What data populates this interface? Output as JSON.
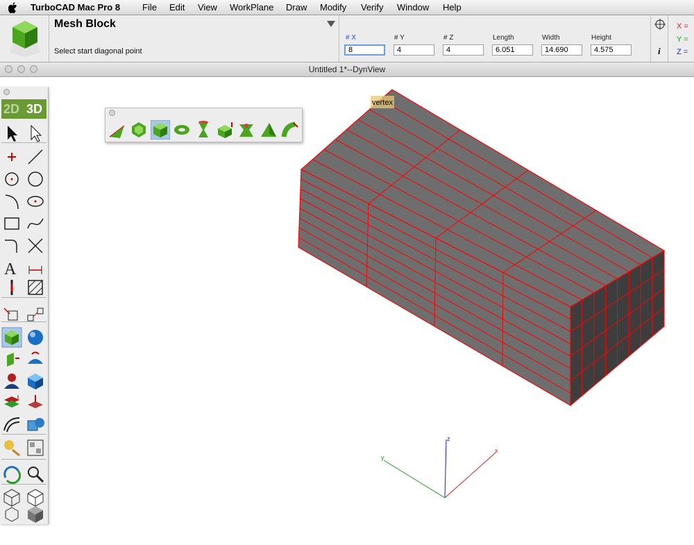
{
  "menubar": {
    "app_name": "TurboCAD Mac Pro 8",
    "items": [
      "File",
      "Edit",
      "View",
      "WorkPlane",
      "Draw",
      "Modify",
      "Verify",
      "Window",
      "Help"
    ]
  },
  "propbar": {
    "tool_title": "Mesh Block",
    "prompt": "Select start diagonal point",
    "fields": [
      {
        "label": "# X",
        "value": "8"
      },
      {
        "label": "# Y",
        "value": "4"
      },
      {
        "label": "# Z",
        "value": "4"
      },
      {
        "label": "Length",
        "value": "6.051"
      },
      {
        "label": "Width",
        "value": "14.690"
      },
      {
        "label": "Height",
        "value": "4.575"
      }
    ],
    "coords": {
      "x": "X =",
      "y": "Y =",
      "z": "Z ="
    },
    "info_label": "i"
  },
  "window": {
    "title": "Untitled 1*--DynView"
  },
  "toolbar": {
    "tab_2d": "2D",
    "tab_3d": "3D"
  },
  "viewport": {
    "snap_label": "vertex",
    "axes": {
      "x": "x",
      "y": "y",
      "z": "z"
    },
    "mesh_divisions": {
      "x": 8,
      "y": 4,
      "z": 4
    },
    "colors": {
      "face": "#6e6e6e",
      "edge": "#ff0000",
      "x_axis": "#e02020",
      "y_axis": "#1a9a1a",
      "z_axis": "#1a1ae0"
    }
  }
}
